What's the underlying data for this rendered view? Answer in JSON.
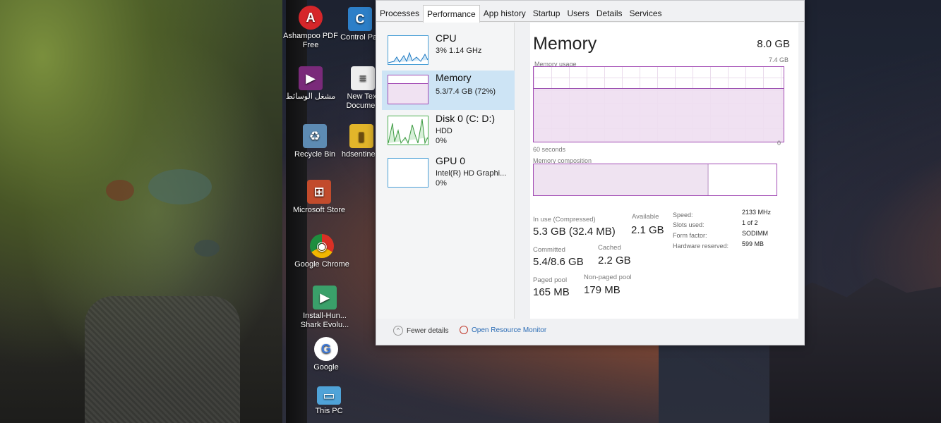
{
  "desktop_icons": [
    {
      "name": "ashampoo-pdf-icon",
      "label": "Ashampoo PDF Free",
      "color": "#d6262a",
      "glyph": "A"
    },
    {
      "name": "control-panel-icon",
      "label": "Control Par",
      "color": "#2d7fc8",
      "glyph": "C"
    },
    {
      "name": "media-player-icon",
      "label": "مشغل الوسائط",
      "color": "#7a2a7a",
      "glyph": "▶"
    },
    {
      "name": "text-document-icon",
      "label": "New Text Documen",
      "color": "#eeeeee",
      "glyph": "≡"
    },
    {
      "name": "recycle-bin-icon",
      "label": "Recycle Bin",
      "color": "#5d8bb3",
      "glyph": "♻"
    },
    {
      "name": "hdsentinel-icon",
      "label": "hdsentinel_",
      "color": "#e2b52a",
      "glyph": "▮"
    },
    {
      "name": "microsoft-store-icon",
      "label": "Microsoft Store",
      "color": "#c24b2c",
      "glyph": "⊞"
    },
    {
      "name": "google-chrome-icon",
      "label": "Google Chrome",
      "color": "#2f8f4a",
      "glyph": "◉"
    },
    {
      "name": "installer-icon",
      "label": "Install-Hun... Shark Evolu...",
      "color": "#3aa06a",
      "glyph": "▶"
    },
    {
      "name": "google-icon",
      "label": "Google",
      "color": "#3c78d8",
      "glyph": "G"
    },
    {
      "name": "this-pc-icon",
      "label": "This PC",
      "color": "#4fa3d8",
      "glyph": "▭"
    }
  ],
  "tabs": [
    "Processes",
    "Performance",
    "App history",
    "Startup",
    "Users",
    "Details",
    "Services"
  ],
  "active_tab": "Performance",
  "sidebar": [
    {
      "title": "CPU",
      "sub1": "3% 1.14 GHz",
      "sub2": ""
    },
    {
      "title": "Memory",
      "sub1": "5.3/7.4 GB (72%)",
      "sub2": ""
    },
    {
      "title": "Disk 0 (C: D:)",
      "sub1": "HDD",
      "sub2": "0%"
    },
    {
      "title": "GPU 0",
      "sub1": "Intel(R) HD Graphi...",
      "sub2": "0%"
    }
  ],
  "memory": {
    "title": "Memory",
    "total": "8.0 GB",
    "usage_label": "Memory usage",
    "usage_max": "7.4 GB",
    "usage_fraction": 0.72,
    "x_label": "60 seconds",
    "y_min": "0",
    "composition_label": "Memory composition",
    "composition_used_fraction": 0.72,
    "stats": {
      "in_use_label": "In use (Compressed)",
      "in_use_value": "5.3 GB (32.4 MB)",
      "available_label": "Available",
      "available_value": "2.1 GB",
      "committed_label": "Committed",
      "committed_value": "5.4/8.6 GB",
      "cached_label": "Cached",
      "cached_value": "2.2 GB",
      "paged_label": "Paged pool",
      "paged_value": "165 MB",
      "nonpaged_label": "Non-paged pool",
      "nonpaged_value": "179 MB"
    },
    "details": [
      {
        "label": "Speed:",
        "value": "2133 MHz"
      },
      {
        "label": "Slots used:",
        "value": "1 of 2"
      },
      {
        "label": "Form factor:",
        "value": "SODIMM"
      },
      {
        "label": "Hardware reserved:",
        "value": "599 MB"
      }
    ]
  },
  "footer": {
    "fewer_details": "Fewer details",
    "open_monitor": "Open Resource Monitor"
  },
  "colors": {
    "accent_blue": "#4a9fd6",
    "memory_purple": "#a24bb4",
    "link_blue": "#2b6cb5"
  }
}
